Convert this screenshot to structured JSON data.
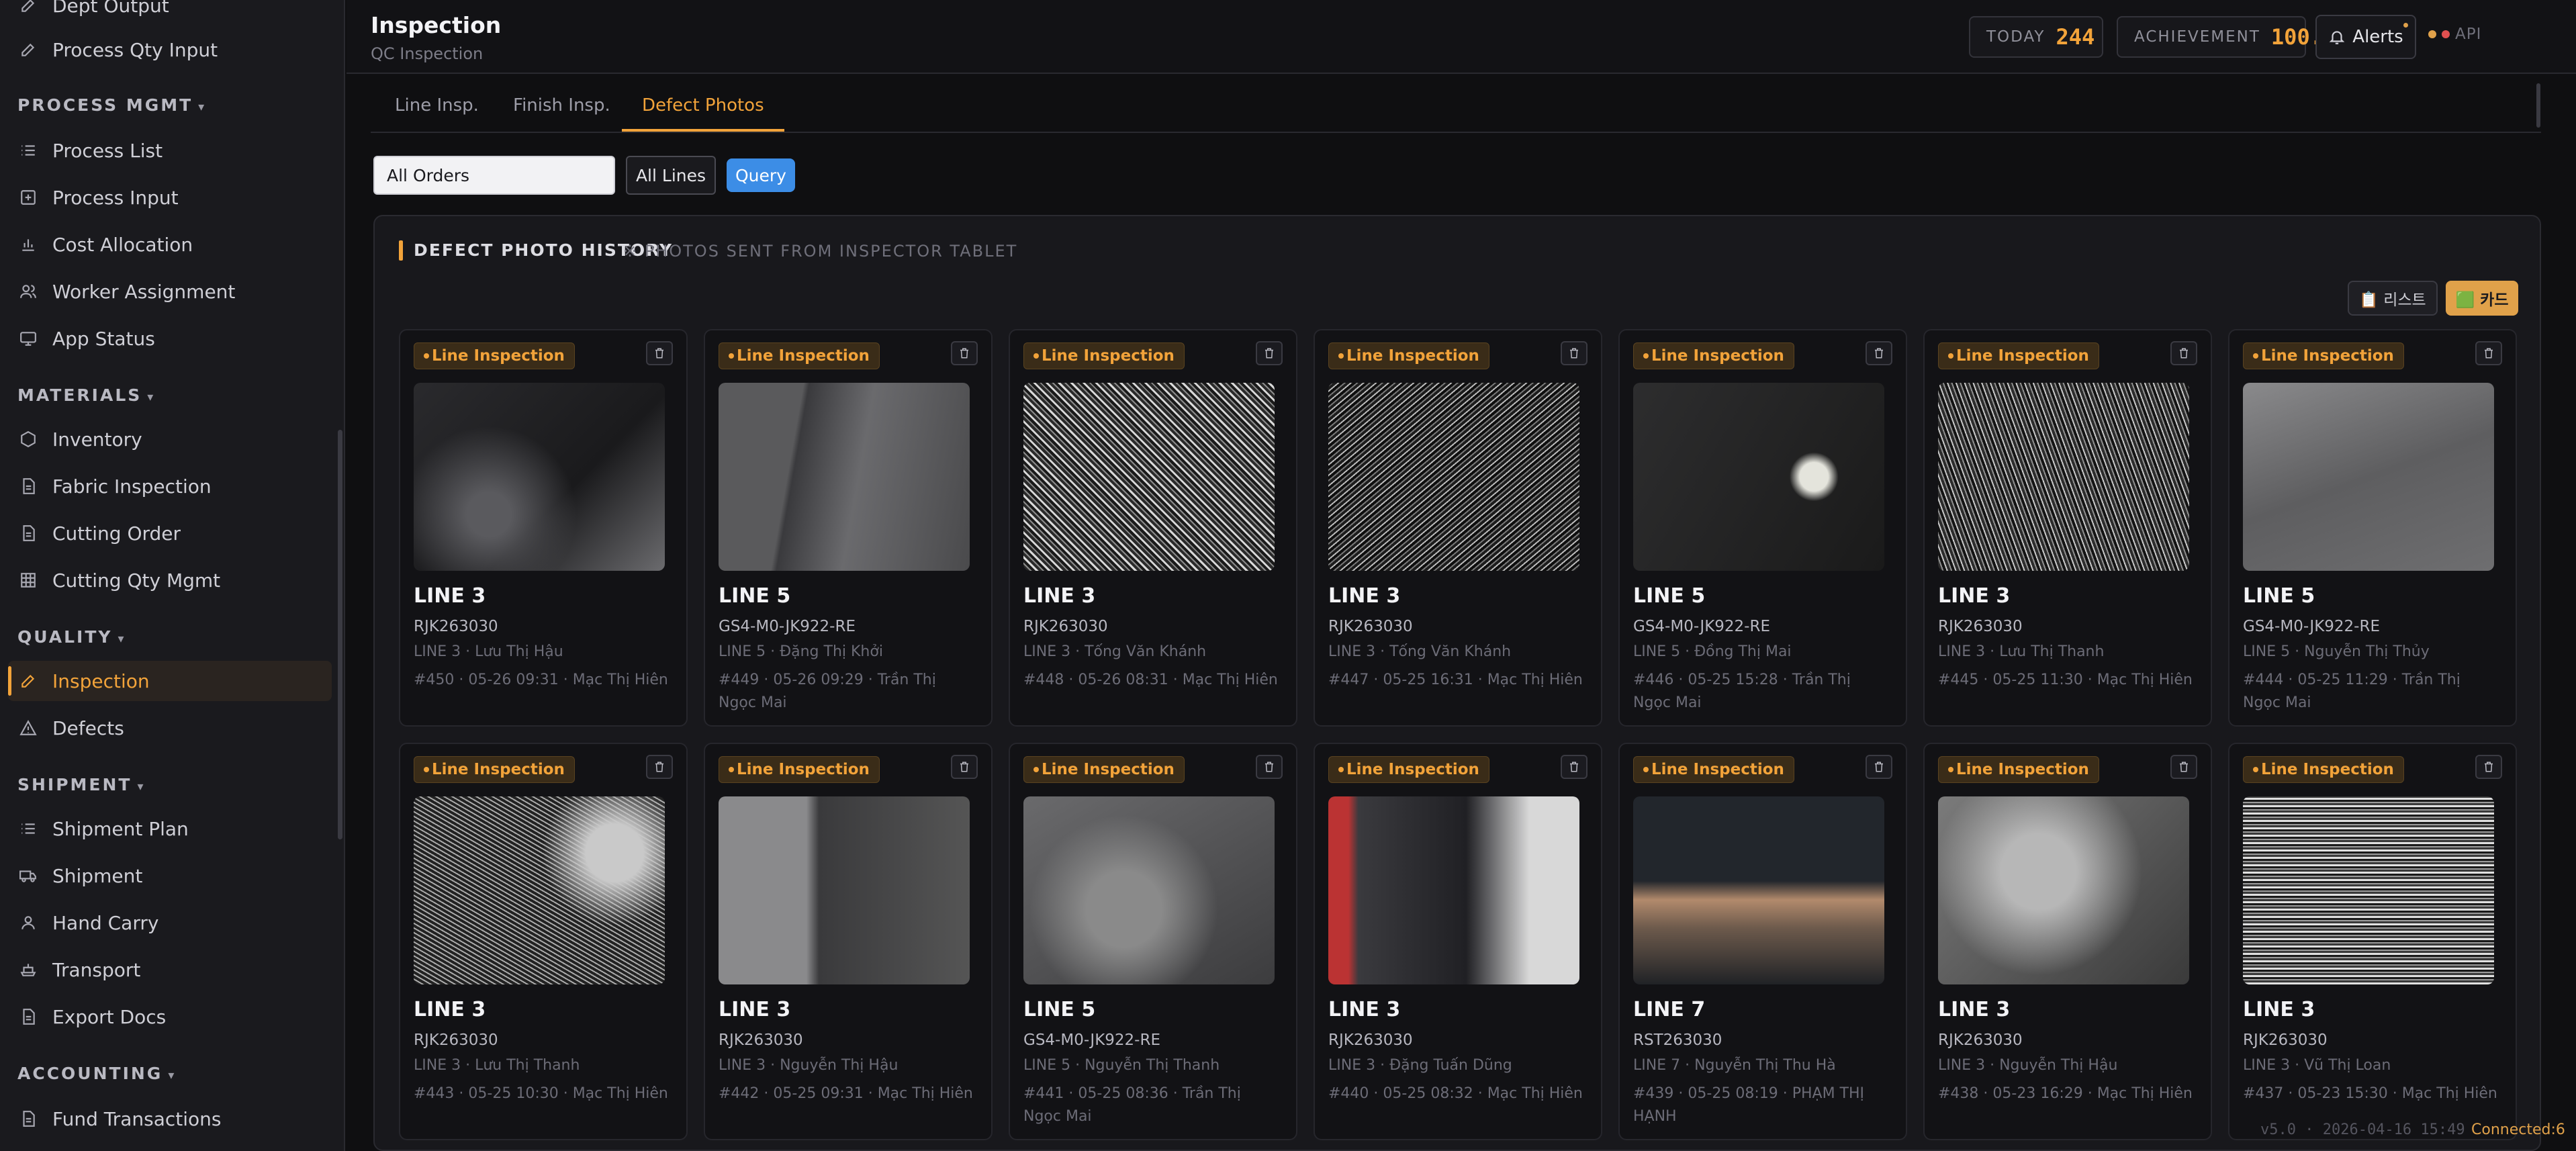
{
  "sidebar": {
    "items_top": [
      {
        "label": "Dept Output",
        "icon": "pencil-icon"
      },
      {
        "label": "Process Qty Input",
        "icon": "pencil-icon"
      }
    ],
    "sections": [
      {
        "title": "PROCESS MGMT",
        "items": [
          {
            "label": "Process List",
            "icon": "list-icon"
          },
          {
            "label": "Process Input",
            "icon": "plus-square-icon"
          },
          {
            "label": "Cost Allocation",
            "icon": "bar-chart-icon"
          },
          {
            "label": "Worker Assignment",
            "icon": "users-icon"
          },
          {
            "label": "App Status",
            "icon": "monitor-icon"
          }
        ]
      },
      {
        "title": "MATERIALS",
        "items": [
          {
            "label": "Inventory",
            "icon": "hexagon-icon"
          },
          {
            "label": "Fabric Inspection",
            "icon": "file-icon"
          },
          {
            "label": "Cutting Order",
            "icon": "file-icon"
          },
          {
            "label": "Cutting Qty Mgmt",
            "icon": "grid-icon"
          }
        ]
      },
      {
        "title": "QUALITY",
        "items": [
          {
            "label": "Inspection",
            "icon": "pencil-icon",
            "active": true
          },
          {
            "label": "Defects",
            "icon": "warning-icon"
          }
        ]
      },
      {
        "title": "SHIPMENT",
        "items": [
          {
            "label": "Shipment Plan",
            "icon": "list-icon"
          },
          {
            "label": "Shipment",
            "icon": "truck-icon"
          },
          {
            "label": "Hand Carry",
            "icon": "user-icon"
          },
          {
            "label": "Transport",
            "icon": "ship-icon"
          },
          {
            "label": "Export Docs",
            "icon": "file-icon"
          }
        ]
      },
      {
        "title": "ACCOUNTING",
        "items": [
          {
            "label": "Fund Transactions",
            "icon": "file-icon"
          }
        ]
      }
    ]
  },
  "header": {
    "title": "Inspection",
    "subtitle": "QC Inspection",
    "today_label": "TODAY",
    "today_value": "244",
    "achievement_label": "ACHIEVEMENT",
    "achievement_value": "100.0%",
    "alerts_label": "Alerts",
    "api_label": "API"
  },
  "tabs": [
    "Line Insp.",
    "Finish Insp.",
    "Defect Photos"
  ],
  "active_tab": 2,
  "filters": {
    "order": "All Orders",
    "lines": "All Lines",
    "query_label": "Query"
  },
  "panel": {
    "title": "DEFECT PHOTO HISTORY",
    "subtitle": "※ PHOTOS SENT FROM INSPECTOR TABLET",
    "view_list_label": "📋 리스트",
    "view_card_label": "🟩 카드"
  },
  "cards": [
    {
      "badge": "Line Inspection",
      "line": "LINE 3",
      "order": "RJK263030",
      "meta": "LINE 3 · Lưu Thị Hậu",
      "record": "#450 · 05-26 09:31 · Mạc Thị Hiên",
      "photo": "dark-fabric"
    },
    {
      "badge": "Line Inspection",
      "line": "LINE 5",
      "order": "GS4-M0-JK922-RE",
      "meta": "LINE 5 · Đặng Thị Khởi",
      "record": "#449 · 05-26 09:29 · Trần Thị Ngọc Mai",
      "photo": "grey-fold"
    },
    {
      "badge": "Line Inspection",
      "line": "LINE 3",
      "order": "RJK263030",
      "meta": "LINE 3 · Tống Văn Khánh",
      "record": "#448 · 05-26 08:31 · Mạc Thị Hiên",
      "photo": "tweed"
    },
    {
      "badge": "Line Inspection",
      "line": "LINE 3",
      "order": "RJK263030",
      "meta": "LINE 3 · Tống Văn Khánh",
      "record": "#447 · 05-25 16:31 · Mạc Thị Hiên",
      "photo": "tweed-dark"
    },
    {
      "badge": "Line Inspection",
      "line": "LINE 5",
      "order": "GS4-M0-JK922-RE",
      "meta": "LINE 5 · Đồng Thị Mai",
      "record": "#446 · 05-25 15:28 · Trần Thị Ngọc Mai",
      "photo": "black-bow"
    },
    {
      "badge": "Line Inspection",
      "line": "LINE 3",
      "order": "RJK263030",
      "meta": "LINE 3 · Lưu Thị Thanh",
      "record": "#445 · 05-25 11:30 · Mạc Thị Hiên",
      "photo": "tweed-edge"
    },
    {
      "badge": "Line Inspection",
      "line": "LINE 5",
      "order": "GS4-M0-JK922-RE",
      "meta": "LINE 5 · Nguyễn Thị Thủy",
      "record": "#444 · 05-25 11:29 · Trần Thị Ngọc Mai",
      "photo": "grey-pocket"
    },
    {
      "badge": "Line Inspection",
      "line": "LINE 3",
      "order": "RJK263030",
      "meta": "LINE 3 · Lưu Thị Thanh",
      "record": "#443 · 05-25 10:30 · Mạc Thị Hiên",
      "photo": "tweed-sleeve"
    },
    {
      "badge": "Line Inspection",
      "line": "LINE 3",
      "order": "RJK263030",
      "meta": "LINE 3 · Nguyễn Thị Hậu",
      "record": "#442 · 05-25 09:31 · Mạc Thị Hiên",
      "photo": "tweed-lining"
    },
    {
      "badge": "Line Inspection",
      "line": "LINE 5",
      "order": "GS4-M0-JK922-RE",
      "meta": "LINE 5 · Nguyễn Thị Thanh",
      "record": "#441 · 05-25 08:36 · Trần Thị Ngọc Mai",
      "photo": "grey-water"
    },
    {
      "badge": "Line Inspection",
      "line": "LINE 3",
      "order": "RJK263030",
      "meta": "LINE 3 · Đặng Tuấn Dũng",
      "record": "#440 · 05-25 08:32 · Mạc Thị Hiên",
      "photo": "knit-red"
    },
    {
      "badge": "Line Inspection",
      "line": "LINE 7",
      "order": "RST263030",
      "meta": "LINE 7 · Nguyễn Thị Thu Hà",
      "record": "#439 · 05-25 08:19 · PHẠM THỊ HẠNH",
      "photo": "knit-hand"
    },
    {
      "badge": "Line Inspection",
      "line": "LINE 3",
      "order": "RJK263030",
      "meta": "LINE 3 · Nguyễn Thị Hậu",
      "record": "#438 · 05-23 16:29 · Mạc Thị Hiên",
      "photo": "grey-silk"
    },
    {
      "badge": "Line Inspection",
      "line": "LINE 3",
      "order": "RJK263030",
      "meta": "LINE 3 · Vũ Thị Loan",
      "record": "#437 · 05-23 15:30 · Mạc Thị Hiên",
      "photo": "tweed-light"
    }
  ],
  "footer": {
    "version": "v5.0 · 2026-04-16 15:49",
    "connection": "Connected:6"
  },
  "colors": {
    "accent": "#f2a33a",
    "primary_button": "#3c8de6",
    "background": "#0f0f11",
    "sidebar": "#1a1a1e"
  }
}
